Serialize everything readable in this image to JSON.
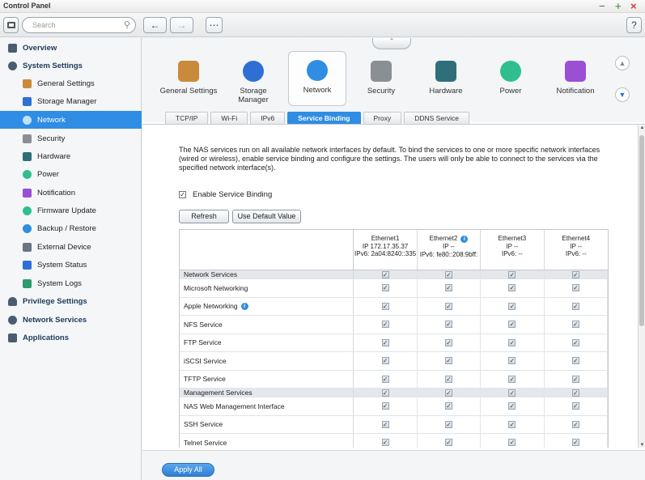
{
  "window": {
    "title": "Control Panel",
    "minimize": "−",
    "maximize": "+",
    "close": "×"
  },
  "toolbar": {
    "search_placeholder": "Search",
    "back": "←",
    "forward": "→",
    "apps": "⋯",
    "help": "?"
  },
  "sidebar": {
    "items": [
      {
        "label": "Overview"
      },
      {
        "label": "System Settings"
      },
      {
        "label": "General Settings"
      },
      {
        "label": "Storage Manager"
      },
      {
        "label": "Network"
      },
      {
        "label": "Security"
      },
      {
        "label": "Hardware"
      },
      {
        "label": "Power"
      },
      {
        "label": "Notification"
      },
      {
        "label": "Firmware Update"
      },
      {
        "label": "Backup / Restore"
      },
      {
        "label": "External Device"
      },
      {
        "label": "System Status"
      },
      {
        "label": "System Logs"
      },
      {
        "label": "Privilege Settings"
      },
      {
        "label": "Network Services"
      },
      {
        "label": "Applications"
      }
    ]
  },
  "categories": [
    {
      "label": "General Settings",
      "color": "#c98a3a"
    },
    {
      "label": "Storage Manager",
      "color": "#2f6fd4"
    },
    {
      "label": "Network",
      "color": "#2f8de4"
    },
    {
      "label": "Security",
      "color": "#8a8f94"
    },
    {
      "label": "Hardware",
      "color": "#2f6f7a"
    },
    {
      "label": "Power",
      "color": "#2fbf8f"
    },
    {
      "label": "Notification",
      "color": "#9a4fd4"
    }
  ],
  "tabs": [
    "TCP/IP",
    "Wi-Fi",
    "IPv6",
    "Service Binding",
    "Proxy",
    "DDNS Service"
  ],
  "content": {
    "description": "The NAS services run on all available network interfaces by default. To bind the services to one or more specific network interfaces (wired or wireless), enable service binding and configure the settings. The users will only be able to connect to the services via the specified network interface(s).",
    "enable_label": "Enable Service Binding",
    "refresh": "Refresh",
    "use_default": "Use Default Value"
  },
  "grid": {
    "columns": [
      {
        "l1": "Ethernet1",
        "l2": "IP 172.17.35.37",
        "l3": "IPv6: 2a04:8240::335"
      },
      {
        "l1": "Ethernet2",
        "l2": "IP --",
        "l3": "IPv6: fe80::208:9bff:"
      },
      {
        "l1": "Ethernet3",
        "l2": "IP --",
        "l3": "IPv6: --"
      },
      {
        "l1": "Ethernet4",
        "l2": "IP --",
        "l3": "IPv6: --"
      }
    ],
    "rows": [
      {
        "label": "Network Services",
        "section": true
      },
      {
        "label": "Microsoft Networking"
      },
      {
        "label": "Apple Networking"
      },
      {
        "label": "NFS Service"
      },
      {
        "label": "FTP Service"
      },
      {
        "label": "iSCSI Service"
      },
      {
        "label": "TFTP Service"
      },
      {
        "label": "Management Services",
        "section": true
      },
      {
        "label": "NAS Web Management Interface"
      },
      {
        "label": "SSH Service"
      },
      {
        "label": "Telnet Service"
      }
    ]
  },
  "footer": {
    "apply_all": "Apply All"
  }
}
